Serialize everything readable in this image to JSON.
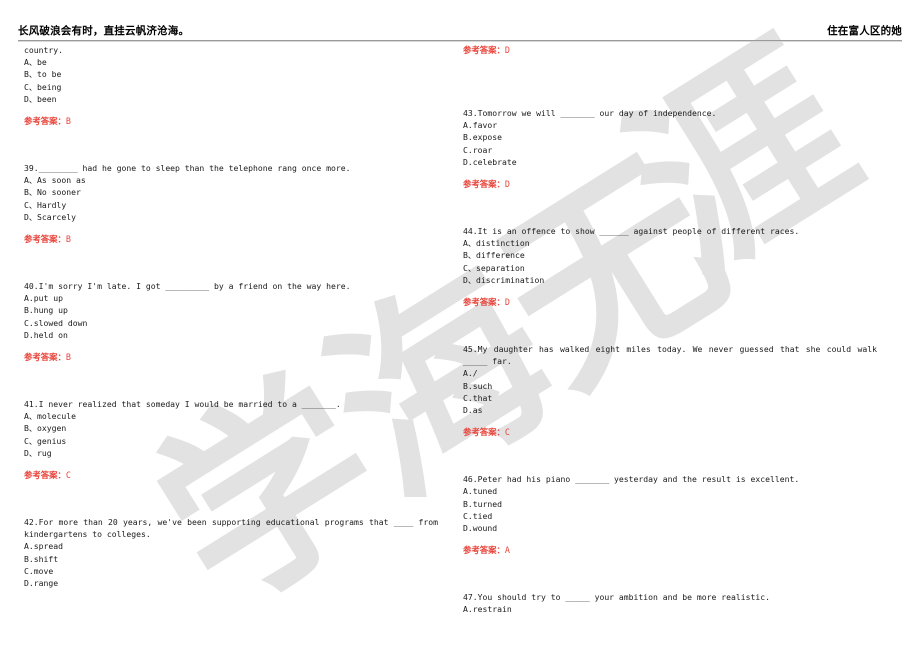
{
  "header": {
    "left_text": "长风破浪会有时，直挂云帆济沧海。",
    "right_text": "住在富人区的她"
  },
  "watermark": {
    "chars": [
      "学",
      "海",
      "无",
      "涯"
    ],
    "color": "#e2e2e2"
  },
  "answer_label": "参考答案：",
  "accent_color": "#e8453c",
  "left_column": {
    "continued_stem": "country.",
    "continued_options": [
      "A、be",
      "B、to be",
      "C、being",
      "D、been"
    ],
    "continued_answer": "B",
    "questions": [
      {
        "number": "39",
        "stem": "39.________ had he gone to sleep than the telephone rang once more.",
        "options": [
          "A、As soon as",
          "B、No sooner",
          "C、Hardly",
          "D、Scarcely"
        ],
        "answer": "B",
        "justify": false
      },
      {
        "number": "40",
        "stem": "40.I'm sorry I'm late. I got _________ by a friend on the way here.",
        "options": [
          "A.put up",
          "B.hung up",
          "C.slowed down",
          "D.held on"
        ],
        "answer": "B",
        "justify": false
      },
      {
        "number": "41",
        "stem": "41.I never realized that someday I would be married to a _______.",
        "options": [
          "A、molecule",
          "B、oxygen",
          "C、genius",
          "D、rug"
        ],
        "answer": "C",
        "justify": false
      },
      {
        "number": "42",
        "stem": "42.For more than 20 years, we've been supporting educational programs that ____ from kindergartens to colleges.",
        "options": [
          "A.spread",
          "B.shift",
          "C.move",
          "D.range"
        ],
        "answer": "",
        "justify": true
      }
    ]
  },
  "right_column": {
    "continued_answer": "D",
    "questions": [
      {
        "number": "43",
        "stem": "43.Tomorrow we will _______ our day of independence.",
        "options": [
          "A.favor",
          "B.expose",
          "C.roar",
          "D.celebrate"
        ],
        "answer": "D",
        "justify": false
      },
      {
        "number": "44",
        "stem": "44.It is an offence to show ______ against people of different races.",
        "options": [
          "A、distinction",
          "B、difference",
          "C、separation",
          "D、discrimination"
        ],
        "answer": "D",
        "justify": false
      },
      {
        "number": "45",
        "stem": "45.My daughter has walked eight miles today. We never guessed that she could walk _____ far.",
        "options": [
          "A./",
          "B.such",
          "C.that",
          "D.as"
        ],
        "answer": "C",
        "justify": true
      },
      {
        "number": "46",
        "stem": "46.Peter had his piano _______ yesterday and the result is excellent.",
        "options": [
          "A.tuned",
          "B.turned",
          "C.tied",
          "D.wound"
        ],
        "answer": "A",
        "justify": false
      },
      {
        "number": "47",
        "stem": "47.You should try to _____ your ambition and be more realistic.",
        "options": [
          "A.restrain"
        ],
        "answer": "",
        "justify": false
      }
    ]
  }
}
